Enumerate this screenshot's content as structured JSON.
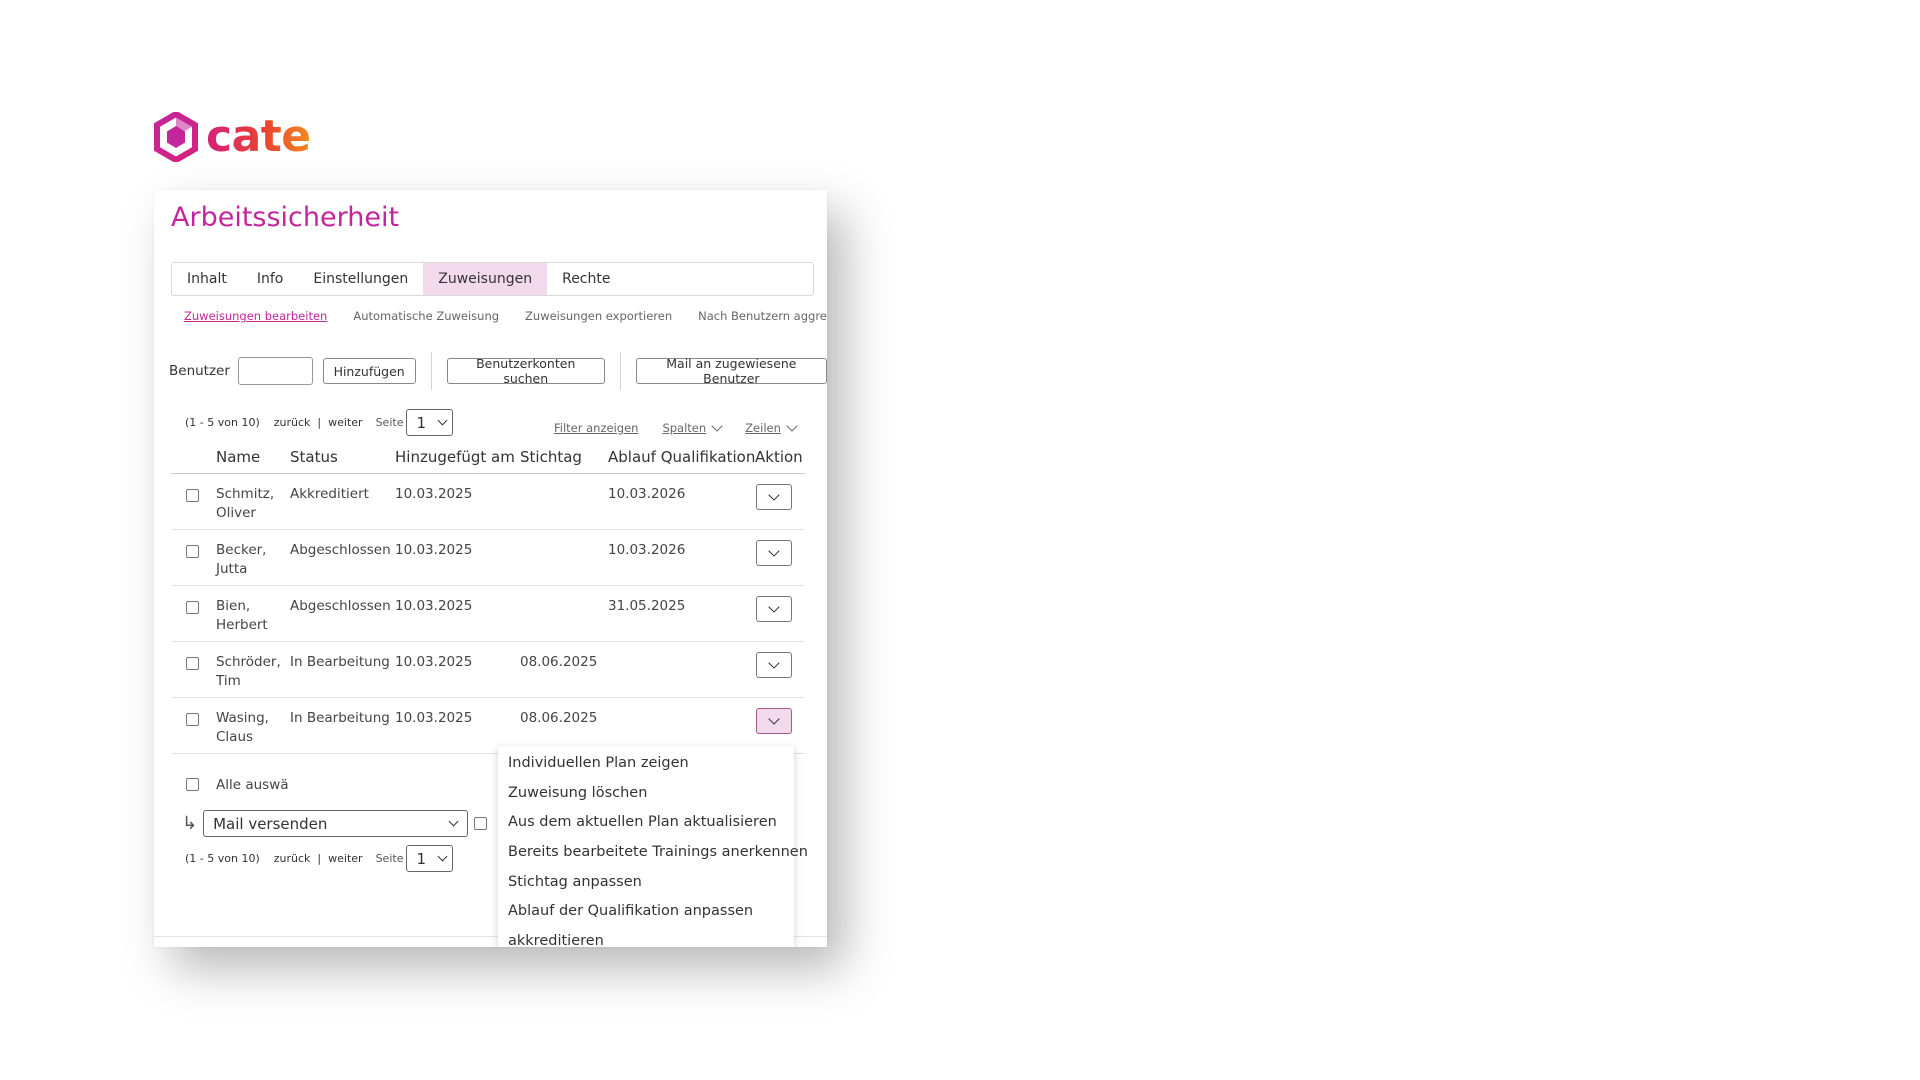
{
  "logo": {
    "text": "cate"
  },
  "page": {
    "title": "Arbeitssicherheit"
  },
  "tabs": [
    {
      "label": "Inhalt",
      "active": false
    },
    {
      "label": "Info",
      "active": false
    },
    {
      "label": "Einstellungen",
      "active": false
    },
    {
      "label": "Zuweisungen",
      "active": true
    },
    {
      "label": "Rechte",
      "active": false
    }
  ],
  "subnav": [
    {
      "label": "Zuweisungen bearbeiten",
      "active": true
    },
    {
      "label": "Automatische Zuweisung",
      "active": false
    },
    {
      "label": "Zuweisungen exportieren",
      "active": false
    },
    {
      "label": "Nach Benutzern aggregiert",
      "active": false
    }
  ],
  "toolbar": {
    "user_label": "Benutzer",
    "user_value": "",
    "add_label": "Hinzufügen",
    "search_accounts_label": "Benutzerkonten suchen",
    "mail_assigned_label": "Mail an zugewiesene Benutzer"
  },
  "pager": {
    "range": "(1 - 5 von 10)",
    "back": "zurück",
    "pipe": "|",
    "next": "weiter",
    "page_label": "Seite",
    "page_value": "1"
  },
  "tools": {
    "filter": "Filter anzeigen",
    "columns": "Spalten",
    "rows": "Zeilen"
  },
  "table": {
    "headers": {
      "name": "Name",
      "status": "Status",
      "added": "Hinzugefügt am",
      "stichtag": "Stichtag",
      "ablauf": "Ablauf Qualifikation",
      "aktion": "Aktion"
    },
    "rows": [
      {
        "name_last": "Schmitz,",
        "name_first": "Oliver",
        "status": "Akkreditiert",
        "added": "10.03.2025",
        "stichtag": "",
        "ablauf": "10.03.2026"
      },
      {
        "name_last": "Becker,",
        "name_first": "Jutta",
        "status": "Abgeschlossen",
        "added": "10.03.2025",
        "stichtag": "",
        "ablauf": "10.03.2026"
      },
      {
        "name_last": "Bien,",
        "name_first": "Herbert",
        "status": "Abgeschlossen",
        "added": "10.03.2025",
        "stichtag": "",
        "ablauf": "31.05.2025"
      },
      {
        "name_last": "Schröder,",
        "name_first": "Tim",
        "status": "In Bearbeitung",
        "added": "10.03.2025",
        "stichtag": "08.06.2025",
        "ablauf": ""
      },
      {
        "name_last": "Wasing,",
        "name_first": "Claus",
        "status": "In Bearbeitung",
        "added": "10.03.2025",
        "stichtag": "08.06.2025",
        "ablauf": ""
      }
    ]
  },
  "select_all_label": "Alle auswä",
  "bulk": {
    "action_value": "Mail versenden",
    "return_glyph": "↳"
  },
  "action_menu": [
    "Individuellen Plan zeigen",
    "Zuweisung löschen",
    "Aus dem aktuellen Plan aktualisieren",
    "Bereits bearbeitete Trainings anerkennen",
    "Stichtag anpassen",
    "Ablauf der Qualifikation anpassen",
    "akkreditieren"
  ],
  "colors": {
    "accent": "#c3269b",
    "tab_active_bg": "#f3d9ec"
  }
}
